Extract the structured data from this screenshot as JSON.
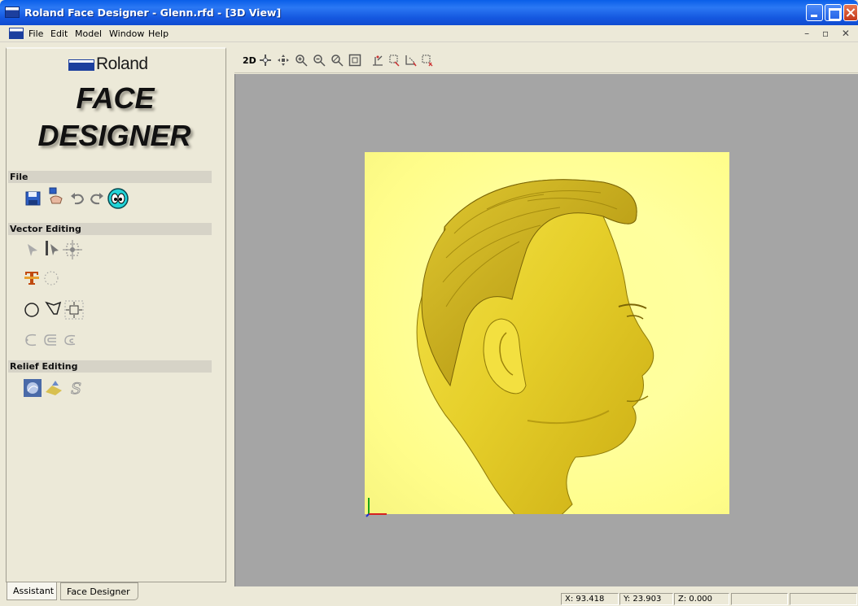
{
  "window": {
    "title": "Roland Face Designer - Glenn.rfd - [3D View]",
    "minimize_icon": "minimize-icon",
    "maximize_icon": "maximize-icon",
    "close_icon": "close-icon"
  },
  "menu": {
    "items": [
      {
        "label": "File",
        "accel": "F"
      },
      {
        "label": "Edit",
        "accel": "E"
      },
      {
        "label": "Model",
        "accel": "M"
      },
      {
        "label": "Window",
        "accel": "W"
      },
      {
        "label": "Help",
        "accel": "H"
      }
    ],
    "mdi_controls": "– ▫ ✕"
  },
  "panel": {
    "brand": "Roland",
    "title_line1": "FACE",
    "title_line2": "DESIGNER",
    "sections": {
      "file": "File",
      "vector": "Vector Editing",
      "relief": "Relief Editing"
    }
  },
  "view": {
    "mode_label": "2D"
  },
  "tabs": {
    "assistant": "Assistant",
    "face_designer": "Face Designer"
  },
  "status": {
    "x": "X: 93.418",
    "y": "Y: 23.903",
    "z": "Z: 0.000"
  },
  "colors": {
    "titlebar": "#0a5fe8",
    "panel_bg": "#ece9d8",
    "viewport_bg": "#a5a5a5",
    "relief_base": "#ffff99",
    "relief_model": "#d8c324"
  }
}
